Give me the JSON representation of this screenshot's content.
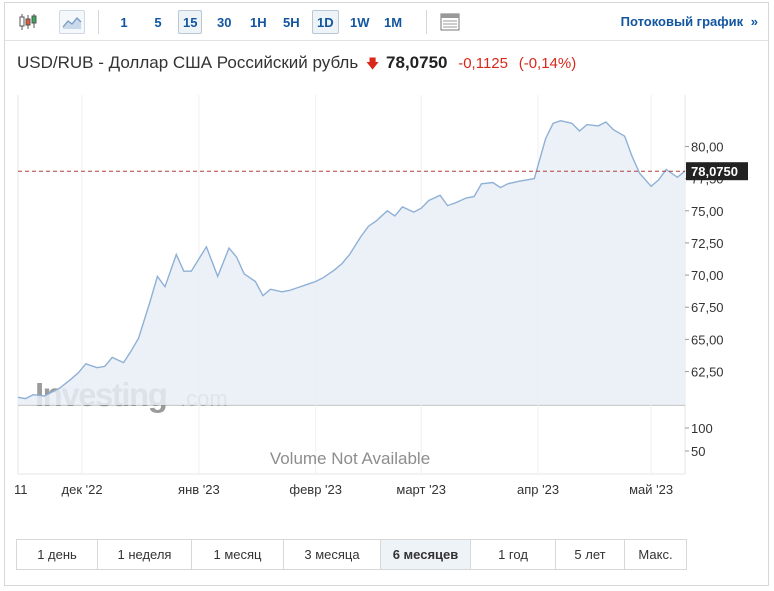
{
  "toolbar": {
    "timeframes": [
      "1",
      "5",
      "15",
      "30",
      "1H",
      "5H",
      "1D",
      "1W",
      "1M"
    ],
    "active_timeframes": [
      "15",
      "1D"
    ],
    "stream_label": "Потоковый график",
    "stream_arrow": "»"
  },
  "header": {
    "pair": "USD/RUB - Доллар США Российский рубль",
    "price": "78,0750",
    "change": "-0,1125",
    "change_pct": "(-0,14%)"
  },
  "colors": {
    "line": "#8fb0d6",
    "fill": "#e8eef6",
    "accent": "#1256a0",
    "negative": "#d8281a",
    "price_tag_bg": "#222222"
  },
  "chart_data": {
    "type": "area",
    "price_ylim": [
      59.9,
      84.0
    ],
    "price_ticks": [
      "80,00",
      "77,50",
      "75,00",
      "72,50",
      "70,00",
      "67,50",
      "65,00",
      "62,50"
    ],
    "price_tick_values": [
      80,
      77.5,
      75,
      72.5,
      70,
      67.5,
      65,
      62.5
    ],
    "current_price_label": "78,0750",
    "current_price": 78.075,
    "volume_ticks": [
      "100",
      "50"
    ],
    "volume_tick_values": [
      100,
      50
    ],
    "volume_ymax": 150,
    "volume_message": "Volume Not Available",
    "x_labels": [
      "11",
      "дек '22",
      "янв '23",
      "февр '23",
      "март '23",
      "апр '23",
      "май '23"
    ],
    "x_label_dates": [
      "2022-11-14",
      "2022-12-01",
      "2023-01-01",
      "2023-02-01",
      "2023-03-01",
      "2023-04-01",
      "2023-05-01"
    ],
    "series": [
      {
        "dates": [
          "2022-11-14",
          "2022-11-16",
          "2022-11-18",
          "2022-11-21",
          "2022-11-23",
          "2022-11-25",
          "2022-11-28",
          "2022-11-30",
          "2022-12-02",
          "2022-12-05",
          "2022-12-07",
          "2022-12-09",
          "2022-12-12",
          "2022-12-14",
          "2022-12-16",
          "2022-12-19",
          "2022-12-21",
          "2022-12-23",
          "2022-12-26",
          "2022-12-28",
          "2022-12-30",
          "2023-01-03",
          "2023-01-06",
          "2023-01-09",
          "2023-01-11",
          "2023-01-13",
          "2023-01-16",
          "2023-01-18",
          "2023-01-20",
          "2023-01-23",
          "2023-01-25",
          "2023-01-27",
          "2023-01-30",
          "2023-02-01",
          "2023-02-03",
          "2023-02-06",
          "2023-02-08",
          "2023-02-10",
          "2023-02-13",
          "2023-02-15",
          "2023-02-17",
          "2023-02-20",
          "2023-02-22",
          "2023-02-24",
          "2023-02-27",
          "2023-03-01",
          "2023-03-03",
          "2023-03-06",
          "2023-03-08",
          "2023-03-10",
          "2023-03-13",
          "2023-03-15",
          "2023-03-17",
          "2023-03-20",
          "2023-03-22",
          "2023-03-24",
          "2023-03-27",
          "2023-03-29",
          "2023-03-31",
          "2023-04-03",
          "2023-04-05",
          "2023-04-07",
          "2023-04-10",
          "2023-04-12",
          "2023-04-14",
          "2023-04-17",
          "2023-04-19",
          "2023-04-21",
          "2023-04-24",
          "2023-04-26",
          "2023-04-28",
          "2023-05-01",
          "2023-05-03",
          "2023-05-05",
          "2023-05-08",
          "2023-05-10"
        ],
        "values": [
          60.5,
          60.4,
          60.7,
          60.6,
          60.9,
          61.2,
          61.9,
          62.4,
          63.1,
          62.8,
          62.9,
          63.6,
          63.2,
          64.1,
          65.1,
          67.9,
          69.9,
          69.1,
          71.6,
          70.3,
          70.3,
          72.2,
          69.9,
          72.1,
          71.4,
          70.1,
          69.5,
          68.4,
          68.9,
          68.7,
          68.8,
          69.0,
          69.3,
          69.5,
          69.8,
          70.4,
          70.9,
          71.6,
          73.0,
          73.8,
          74.2,
          75.0,
          74.6,
          75.3,
          74.9,
          75.2,
          75.8,
          76.2,
          75.4,
          75.6,
          76.0,
          76.1,
          77.1,
          77.2,
          76.8,
          77.1,
          77.3,
          77.4,
          77.5,
          80.6,
          81.8,
          82.0,
          81.8,
          81.2,
          81.7,
          81.6,
          81.9,
          81.3,
          80.8,
          79.2,
          77.9,
          76.9,
          77.4,
          78.2,
          77.6,
          78.1
        ]
      }
    ]
  },
  "periods": [
    "1 день",
    "1 неделя",
    "1 месяц",
    "3 месяца",
    "6 месяцев",
    "1 год",
    "5 лет",
    "Макс."
  ],
  "active_period": "6 месяцев"
}
